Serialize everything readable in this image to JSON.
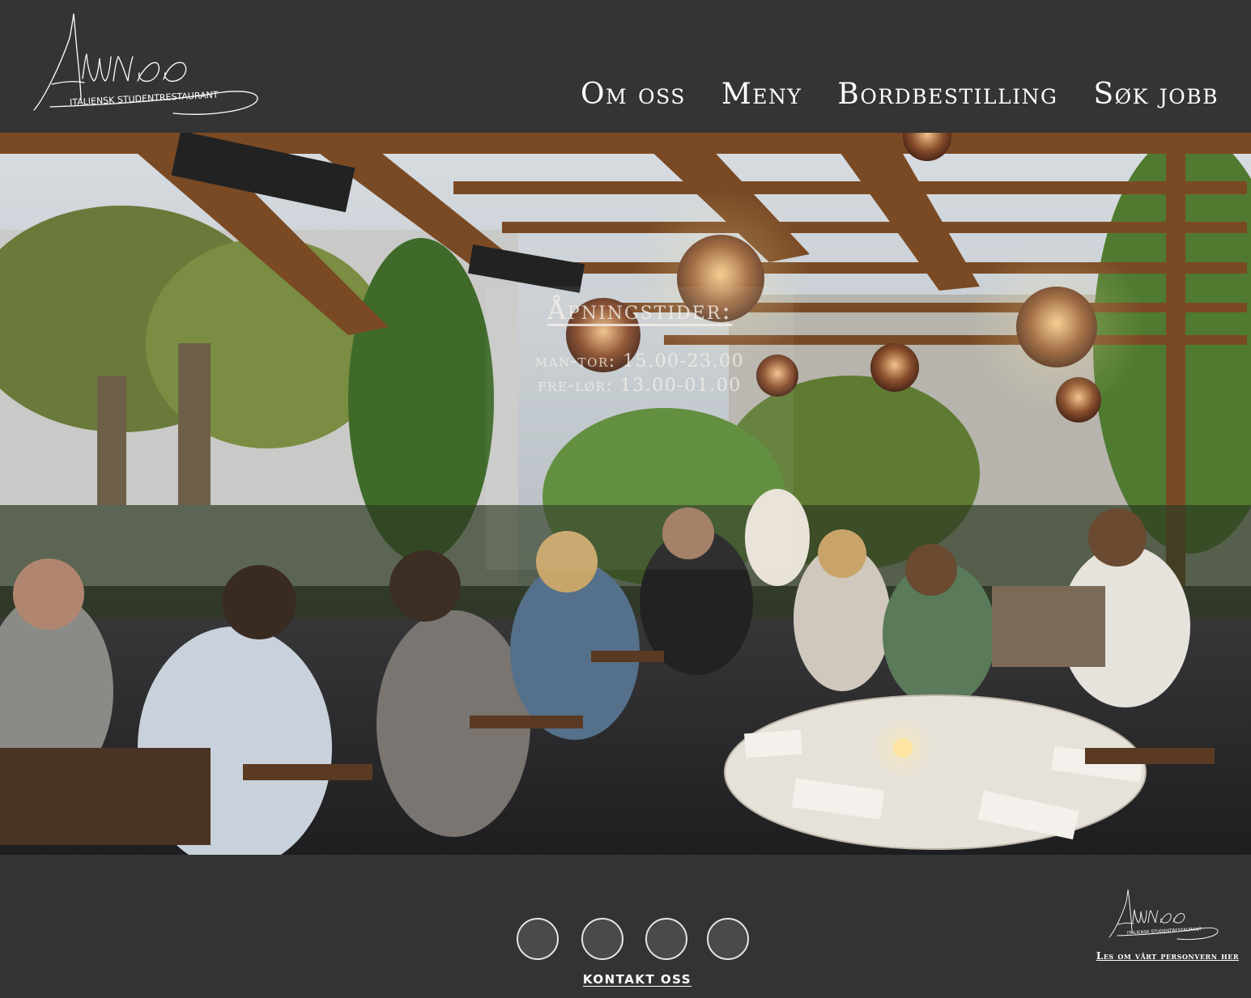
{
  "brand": {
    "logo_wordmark": "Alunno",
    "logo_tagline": "ITALIENSK STUDENTRESTAURANT"
  },
  "nav": {
    "items": [
      {
        "label": "Om oss"
      },
      {
        "label": "Meny"
      },
      {
        "label": "Bordbestilling"
      },
      {
        "label": "Søk jobb"
      }
    ]
  },
  "hero": {
    "image_alt": "Restaurant terrace with diners",
    "hours_title": "Åpningstider:",
    "hours": [
      {
        "text": "man-tor: 15.00-23.00"
      },
      {
        "text": "fre-lør: 13.00-01.00"
      }
    ]
  },
  "footer": {
    "social_icons": [
      "social-icon-1",
      "social-icon-2",
      "social-icon-3",
      "social-icon-4"
    ],
    "contact_label": "KONTAKT OSS",
    "privacy_label": "Les om vårt personvern her"
  },
  "colors": {
    "header_bg": "#343434",
    "footer_bg": "#333333",
    "text": "#ffffff",
    "social_circle": "#4a4a4a"
  }
}
